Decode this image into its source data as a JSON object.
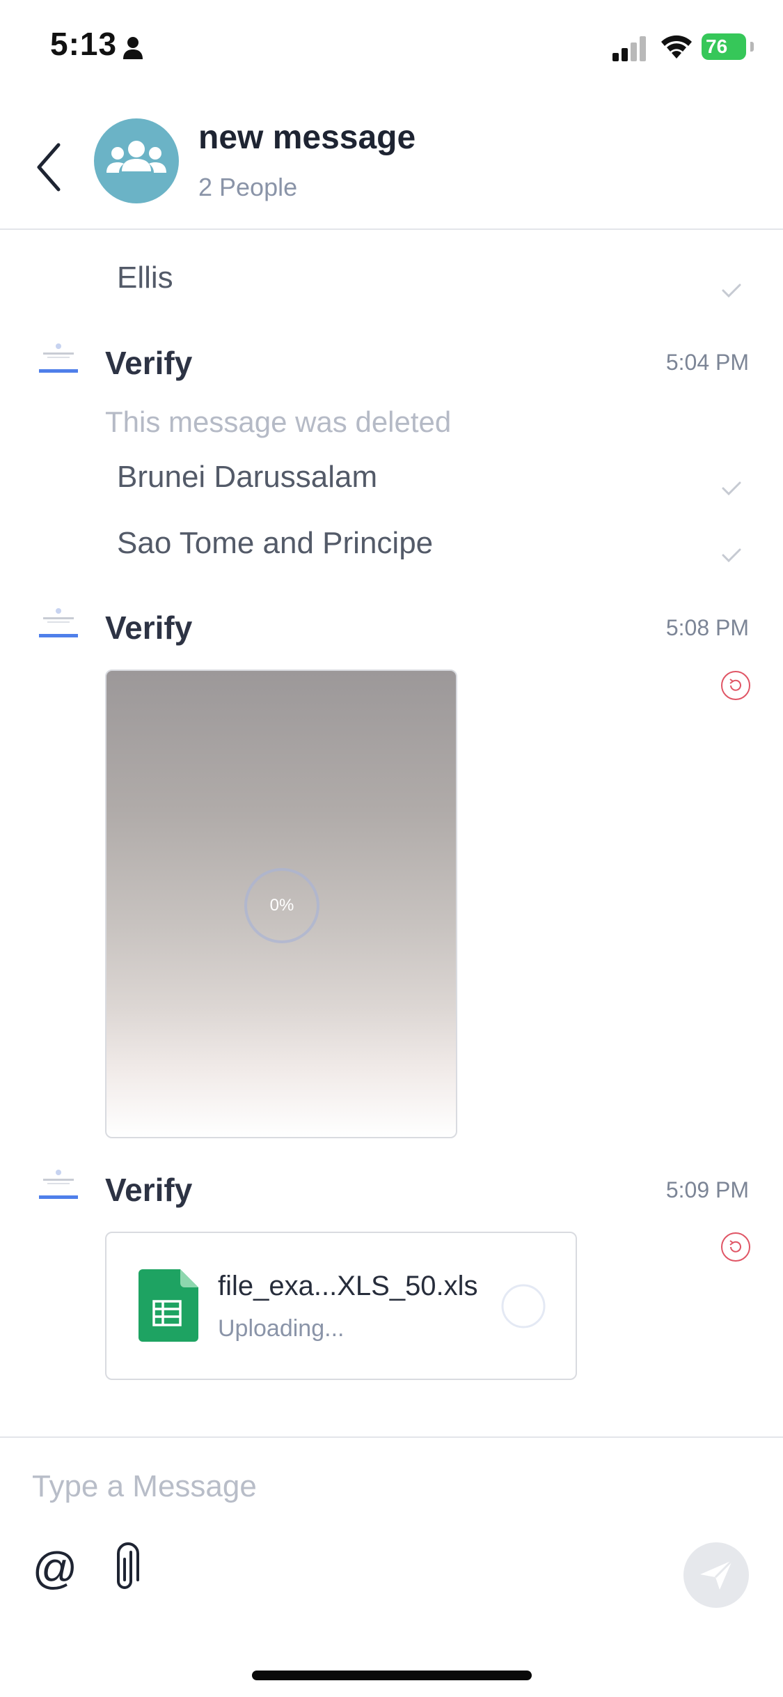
{
  "status_bar": {
    "time": "5:13",
    "battery": "76",
    "icons": [
      "person-icon",
      "signal-icon",
      "wifi-icon",
      "battery-charging-icon"
    ]
  },
  "header": {
    "title": "new message",
    "subtitle": "2 People",
    "avatar_icon": "group-icon",
    "avatar_color": "#6bb3c6"
  },
  "messages": [
    {
      "type": "text",
      "text": "Ellis",
      "status": "sent"
    },
    {
      "type": "group",
      "sender": "Verify",
      "time": "5:04 PM",
      "items": [
        {
          "type": "deleted",
          "text": "This message was deleted"
        },
        {
          "type": "text",
          "text": "Brunei Darussalam",
          "status": "sent"
        },
        {
          "type": "text",
          "text": "Sao Tome and Principe",
          "status": "sent"
        }
      ]
    },
    {
      "type": "group",
      "sender": "Verify",
      "time": "5:08 PM",
      "items": [
        {
          "type": "image",
          "progress_label": "0%",
          "progress": 0,
          "status": "failed-retry"
        }
      ]
    },
    {
      "type": "group",
      "sender": "Verify",
      "time": "5:09 PM",
      "items": [
        {
          "type": "file",
          "file_name": "file_exa...XLS_50.xls",
          "file_status": "Uploading...",
          "file_icon": "spreadsheet-icon",
          "status": "failed-retry"
        }
      ]
    }
  ],
  "composer": {
    "placeholder": "Type a Message",
    "mention_label": "@",
    "attach_icon": "paperclip-icon",
    "send_icon": "send-icon"
  },
  "colors": {
    "accent_retry": "#e05565",
    "sheet_green": "#1ea362",
    "send_disabled": "#e6e8ec"
  }
}
